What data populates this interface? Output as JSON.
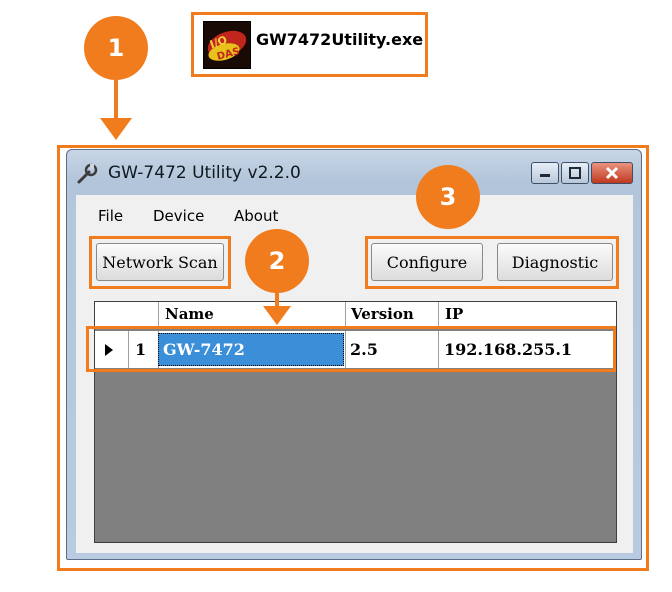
{
  "steps": [
    "1",
    "2",
    "3"
  ],
  "executable": {
    "label": "GW7472Utility.exe",
    "icon": "vxcomm-app-icon"
  },
  "window": {
    "title": "GW-7472 Utility v2.2.0",
    "icon": "wrench-icon",
    "controls": [
      "minimize-icon",
      "maximize-icon",
      "close-icon"
    ]
  },
  "menu": [
    "File",
    "Device",
    "About"
  ],
  "buttons": {
    "network_scan": "Network Scan",
    "configure": "Configure",
    "diagnostic": "Diagnostic"
  },
  "grid": {
    "columns": [
      "Name",
      "Version",
      "IP"
    ],
    "rows": [
      {
        "index": "1",
        "name": "GW-7472",
        "version": "2.5",
        "ip": "192.168.255.1",
        "selected": true
      }
    ]
  },
  "colors": {
    "annotation": "#f07c1e",
    "selection": "#3b8fd8",
    "grid_empty": "#808080"
  }
}
